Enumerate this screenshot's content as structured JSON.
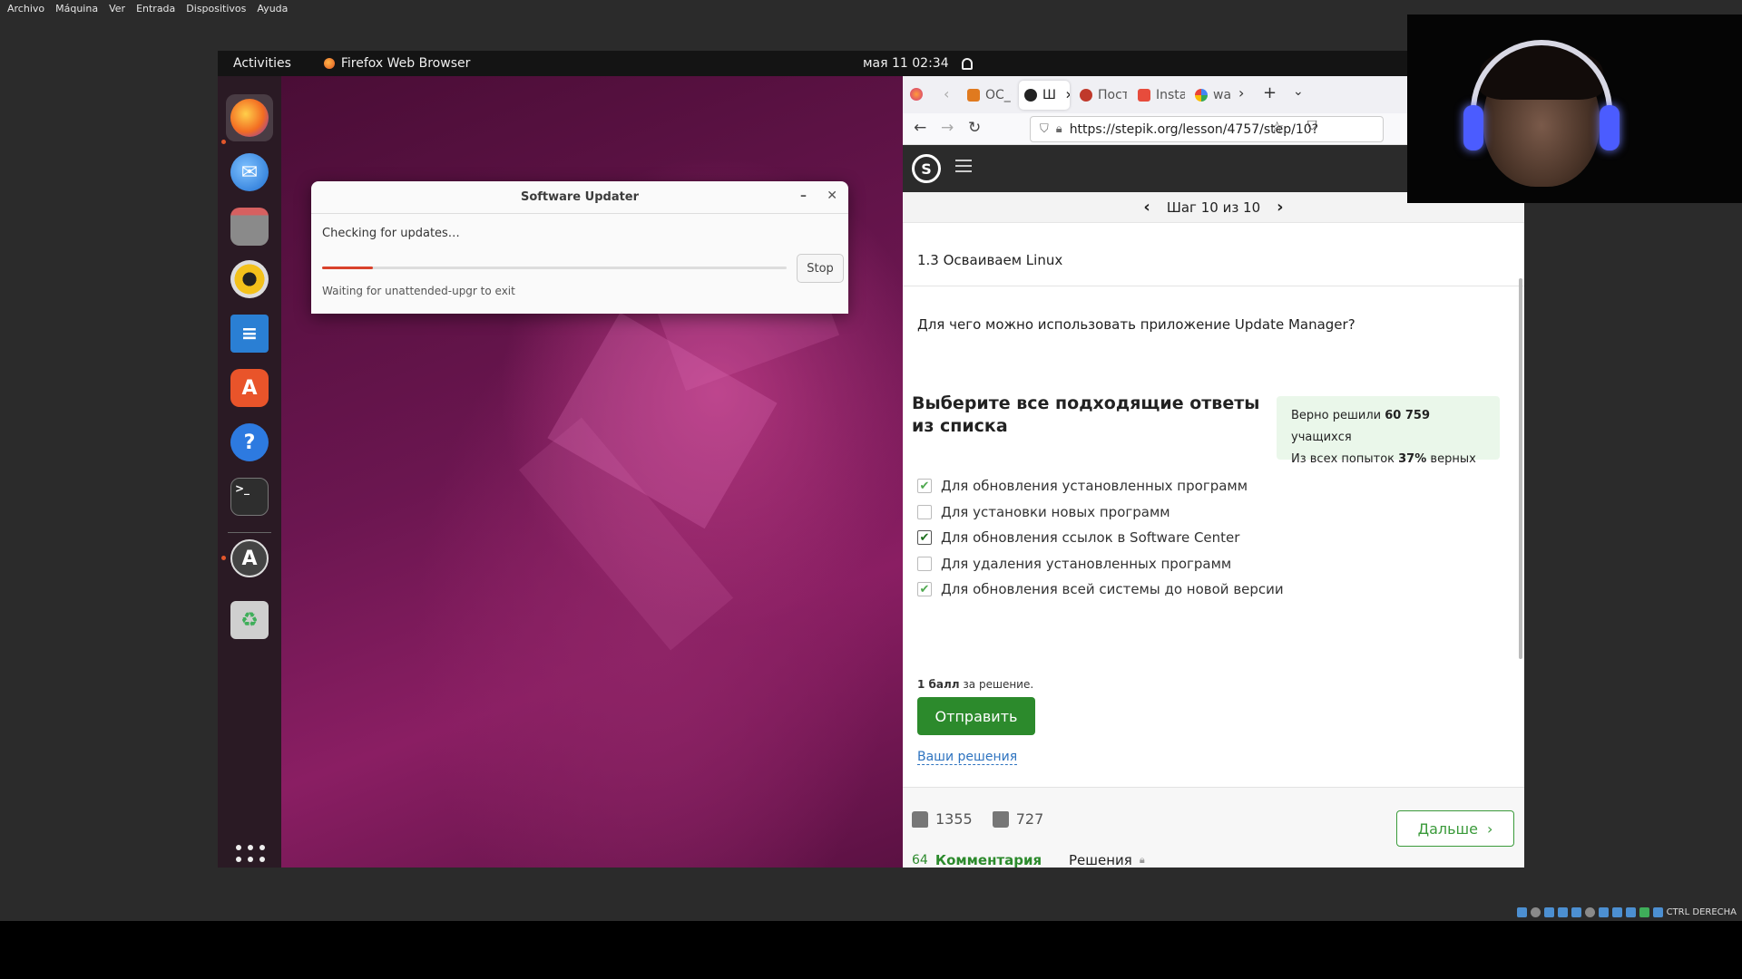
{
  "host": {
    "menu": [
      "Archivo",
      "Máquina",
      "Ver",
      "Entrada",
      "Dispositivos",
      "Ayuda"
    ],
    "status_text": "CTRL DERECHA"
  },
  "ubuntu": {
    "activities": "Activities",
    "app_name": "Firefox Web Browser",
    "clock": "мая 11  02:34",
    "lang": "en"
  },
  "dock": {
    "items": [
      "firefox",
      "thunderbird",
      "files",
      "rhythmbox",
      "libreoffice-writer",
      "ubuntu-software",
      "help",
      "terminal",
      "software-updater",
      "trash"
    ]
  },
  "updater": {
    "title": "Software Updater",
    "status": "Checking for updates…",
    "stop_label": "Stop",
    "sub_status": "Waiting for unattended-upgr to exit",
    "progress": 0.11,
    "progress_color": "#d9412b"
  },
  "firefox": {
    "tabs": [
      "ОС_(",
      "Ш",
      "Пост",
      "Insta",
      "wa"
    ],
    "url": "https://stepik.org/lesson/4757/step/10?"
  },
  "stepik": {
    "step_nav": "Шаг 10 из 10",
    "lesson": "1.3 Осваиваем Linux",
    "question": "Для чего можно использовать приложение Update Manager?",
    "choose_title": "Выберите все подходящие ответы из списка",
    "stats": {
      "line1_pre": "Верно решили",
      "line1_bold": "60 759",
      "line1_post": "учащихся",
      "line2_pre": "Из всех попыток",
      "line2_bold": "37%",
      "line2_post": "верных"
    },
    "options": [
      {
        "label": "Для обновления установленных программ",
        "checked": true
      },
      {
        "label": "Для установки новых программ",
        "checked": false
      },
      {
        "label": "Для обновления ссылок в Software Center",
        "checked": true
      },
      {
        "label": "Для удаления установленных программ",
        "checked": false
      },
      {
        "label": "Для обновления всей системы до новой версии",
        "checked": true
      }
    ],
    "points_bold": "1 балл",
    "points_rest": "за решение.",
    "submit_label": "Отправить",
    "your_solutions": "Ваши решения",
    "likes": "1355",
    "dislikes": "727",
    "next_label": "Дальше",
    "comments_count": "64",
    "comments_label": "Комментария",
    "solutions_label": "Решения",
    "accent_color": "#2c8a2c"
  }
}
